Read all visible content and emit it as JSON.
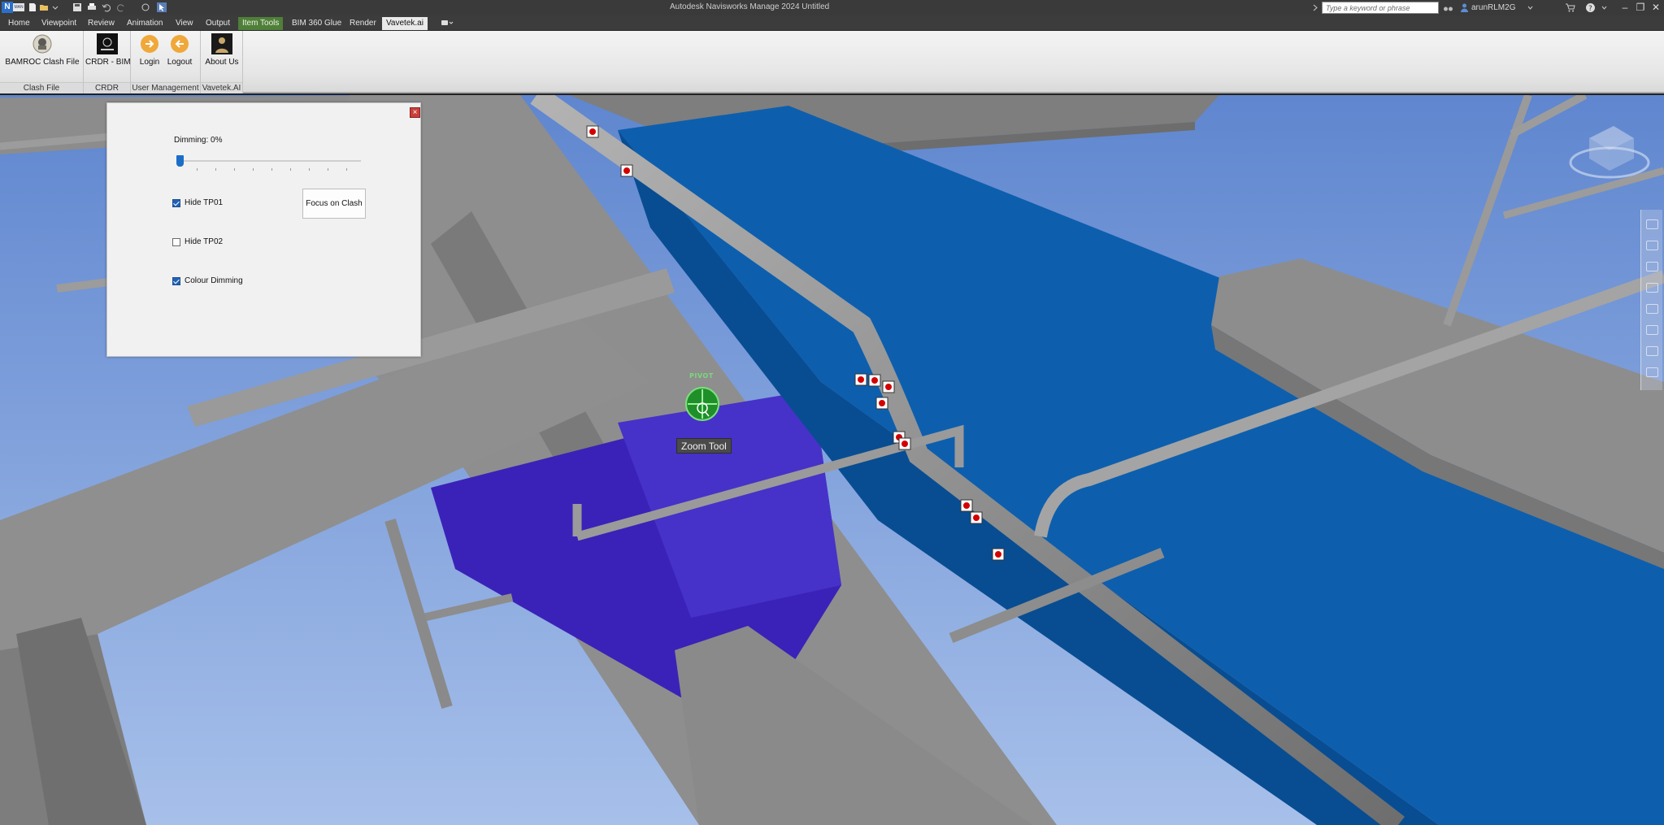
{
  "window": {
    "title": "Autodesk Navisworks Manage 2024   Untitled",
    "app_logo": "N",
    "app_logo_sub": "MAN",
    "search_placeholder": "Type a keyword or phrase",
    "user": "arunRLM2G"
  },
  "menu": {
    "tabs": [
      {
        "label": "Home"
      },
      {
        "label": "Viewpoint"
      },
      {
        "label": "Review"
      },
      {
        "label": "Animation"
      },
      {
        "label": "View"
      },
      {
        "label": "Output"
      },
      {
        "label": "Item Tools"
      },
      {
        "label": "BIM 360 Glue"
      },
      {
        "label": "Render"
      },
      {
        "label": "Vavetek.ai"
      }
    ]
  },
  "ribbon": {
    "groups": [
      {
        "label": "Clash File",
        "buttons": [
          {
            "label": "BAMROC Clash File",
            "icon": "bamroc-logo-icon"
          }
        ]
      },
      {
        "label": "CRDR",
        "buttons": [
          {
            "label": "CRDR - BIM",
            "icon": "crdr-logo-icon"
          }
        ]
      },
      {
        "label": "User Management",
        "buttons": [
          {
            "label": "Login",
            "icon": "login-icon"
          },
          {
            "label": "Logout",
            "icon": "logout-icon"
          }
        ]
      },
      {
        "label": "Vavetek.AI",
        "buttons": [
          {
            "label": "About Us",
            "icon": "about-us-icon"
          }
        ]
      }
    ]
  },
  "panel": {
    "dimming_label": "Dimming: 0%",
    "dimming_value": 0,
    "options": [
      {
        "label": "Hide TP01",
        "checked": true
      },
      {
        "label": "Hide TP02",
        "checked": false
      },
      {
        "label": "Colour Dimming",
        "checked": true
      }
    ],
    "focus_button": "Focus on Clash",
    "close_glyph": "×"
  },
  "viewport": {
    "pivot_label": "PIVOT",
    "tooltip": "Zoom Tool"
  },
  "colors": {
    "duct_blue": "#0d5fae",
    "duct_violet": "#3a22b8",
    "steel_gray": "#8f8f8f",
    "clash_marker": "#d40000",
    "sky_top": "#5f86cf",
    "sky_bottom": "#a7c0ea"
  }
}
